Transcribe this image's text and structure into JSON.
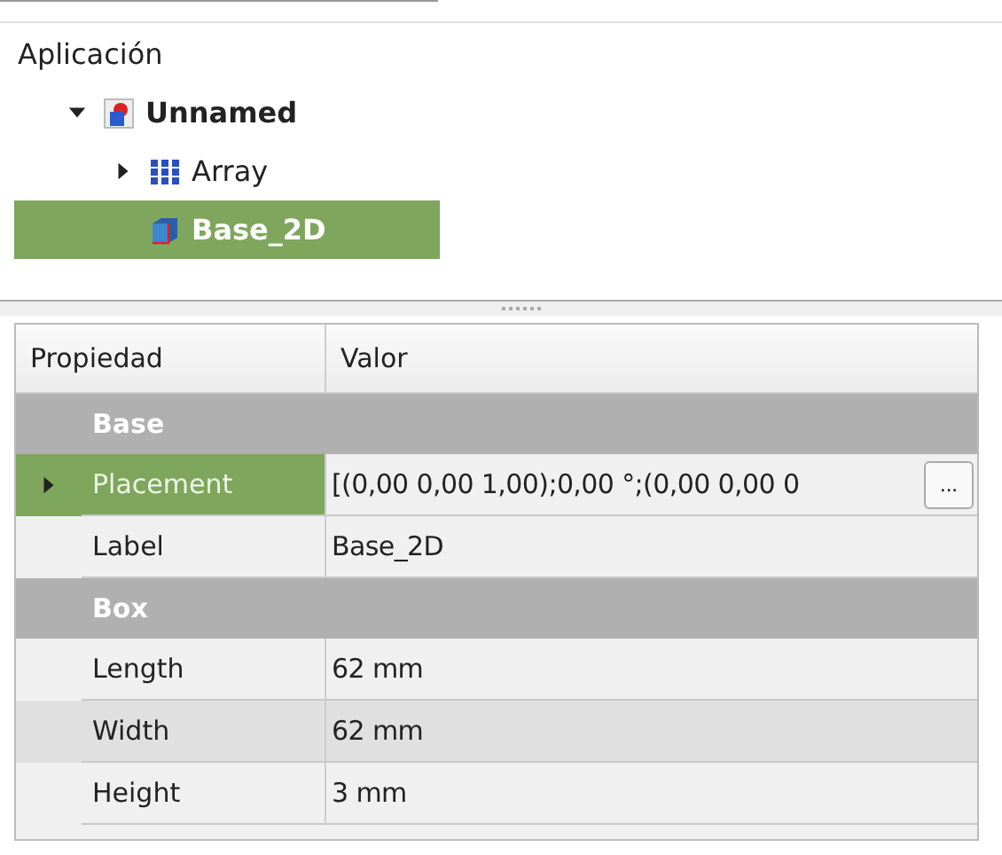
{
  "tree": {
    "root_label": "Aplicación",
    "items": [
      {
        "label": "Unnamed",
        "kind": "document",
        "bold": true,
        "expanded": true,
        "selected": false,
        "children": [
          {
            "label": "Array",
            "kind": "array",
            "expandable": true,
            "expanded": false,
            "selected": false
          },
          {
            "label": "Base_2D",
            "kind": "cube",
            "expandable": false,
            "selected": true
          }
        ]
      }
    ]
  },
  "properties": {
    "columns": [
      "Propiedad",
      "Valor"
    ],
    "rows": [
      {
        "kind": "group",
        "label": "Base"
      },
      {
        "kind": "property",
        "name": "Placement",
        "value": "[(0,00 0,00 1,00);0,00 °;(0,00 0,00 0",
        "button": "...",
        "expandable": true,
        "selected": true,
        "shaded": false
      },
      {
        "kind": "property",
        "name": "Label",
        "value": "Base_2D",
        "expandable": false,
        "selected": false,
        "shaded": false
      },
      {
        "kind": "group",
        "label": "Box"
      },
      {
        "kind": "property",
        "name": "Length",
        "value": "62 mm",
        "expandable": false,
        "selected": false,
        "shaded": false
      },
      {
        "kind": "property",
        "name": "Width",
        "value": "62 mm",
        "expandable": false,
        "selected": false,
        "shaded": true
      },
      {
        "kind": "property",
        "name": "Height",
        "value": "3 mm",
        "expandable": false,
        "selected": false,
        "shaded": false
      }
    ]
  }
}
